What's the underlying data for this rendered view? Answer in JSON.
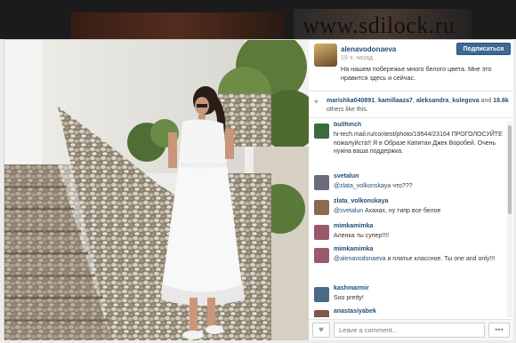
{
  "watermark": "www.sdilock.ru",
  "post": {
    "username": "alenavodonaeva",
    "time": "19 ч. назад",
    "follow_label": "Подписаться",
    "caption": "На нашем побережье много белого цвета. Мне это нравится здесь и сейчас."
  },
  "likes": {
    "user1": "marishka040891",
    "user2": "kamillaaza7",
    "user3": "aleksandra_kolegova",
    "count": "18.6k",
    "suffix": "others like this."
  },
  "comments": [
    {
      "user": "bullfiinch",
      "text": "hi-tech.mail.ru/contest/photo/19544/23164 ПРОГОЛОСУЙТЕ пожалуйста!! Я в Образе Капитан Джек Воробей. Очень нужна ваша поддержка.",
      "color": "#3b6b3a"
    },
    {
      "user": "svetalun",
      "mention": "@zlata_volkonskaya",
      "text": "что???",
      "color": "#6b6b7a"
    },
    {
      "user": "zlata_volkonskaya",
      "mention": "@svetalun",
      "text": "Ахахах, ну типр все белое",
      "color": "#8a6a50"
    },
    {
      "user": "mimkamimka",
      "text": "Аленка ты супер!!!!",
      "color": "#9a5a6a"
    },
    {
      "user": "mimkamimka",
      "mention": "@alenavodonaeva",
      "text": "и платье классное. Ты one and only!!!",
      "color": "#9a5a6a"
    },
    {
      "user": "kashmarmir",
      "text": "Soo pretty!",
      "color": "#4a6a8a"
    },
    {
      "user": "anastasiyabek",
      "text": "",
      "color": "#7a5a4a"
    }
  ],
  "footer": {
    "heart": "♥",
    "comment_placeholder": "Leave a comment...",
    "more": "•••"
  }
}
